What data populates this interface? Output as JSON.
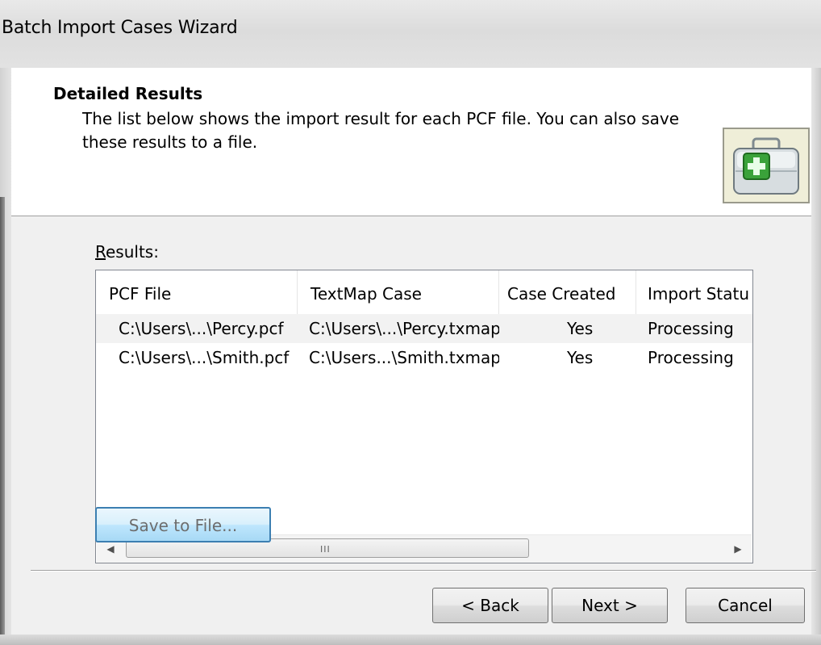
{
  "window": {
    "title": "Batch Import Cases Wizard"
  },
  "header": {
    "title": "Detailed Results",
    "description": "The list below shows the import result for each PCF file.  You can also save these results to a file.",
    "icon": "briefcase-plus-icon"
  },
  "results": {
    "label_mnemonic": "R",
    "label_rest": "esults:",
    "columns": [
      "PCF File",
      "TextMap Case",
      "Case Created",
      "Import Statu"
    ],
    "rows": [
      [
        "C:\\Users\\...\\Percy.pcf",
        "C:\\Users\\...\\Percy.txmap",
        "Yes",
        "Processing"
      ],
      [
        "C:\\Users\\...\\Smith.pcf",
        "C:\\Users...\\Smith.txmap",
        "Yes",
        "Processing"
      ]
    ],
    "scroll_left_icon": "scroll-left-arrow-icon",
    "scroll_right_icon": "scroll-right-arrow-icon",
    "grip": "III"
  },
  "buttons": {
    "save": "Save to File...",
    "back": "< Back",
    "next": "Next >",
    "cancel": "Cancel"
  },
  "colors": {
    "default_button_border": "#3c7fb1",
    "icon_plus": "#3aa23a"
  }
}
